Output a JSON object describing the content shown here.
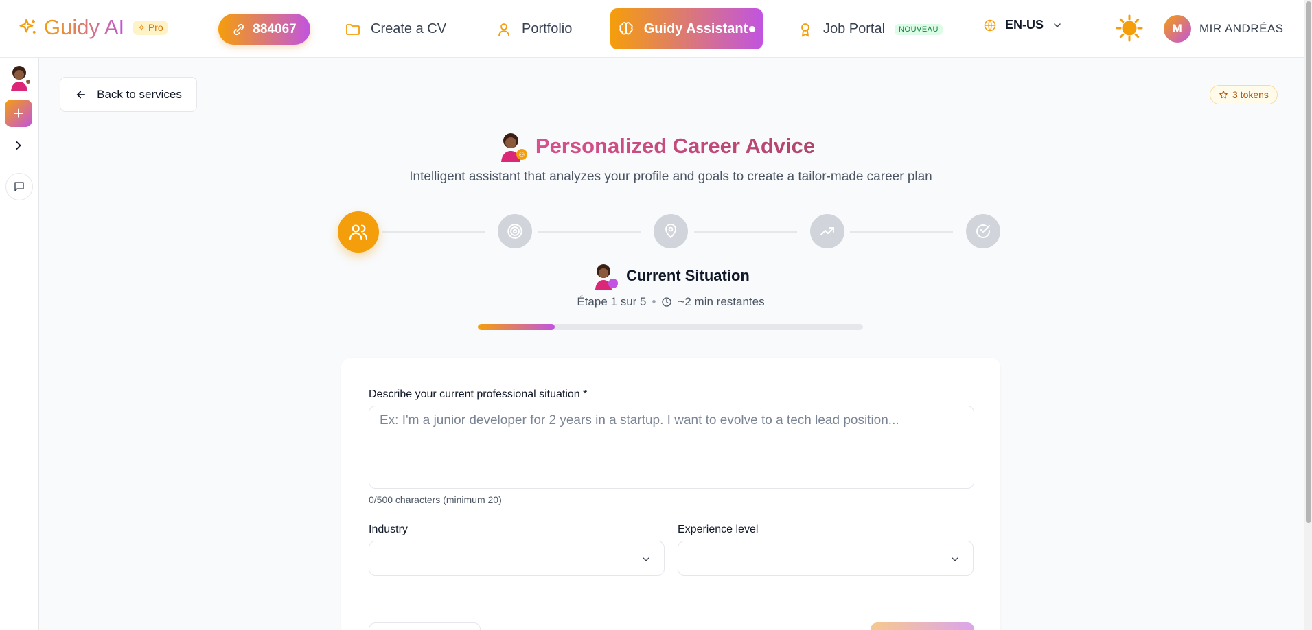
{
  "header": {
    "brand": "Guidy AI",
    "pro_badge": "Pro",
    "points": "884067",
    "nav": [
      {
        "label": "Create a CV",
        "icon": "folder-icon"
      },
      {
        "label": "Portfolio",
        "icon": "user-icon"
      },
      {
        "label": "Guidy Assistant",
        "icon": "brain-icon"
      },
      {
        "label": "Job Portal",
        "icon": "award-icon",
        "badge": "NOUVEAU"
      }
    ],
    "language": "EN-US",
    "user_initial": "M",
    "user_name": "MIR ANDRÉAS"
  },
  "back_label": "Back to services",
  "tokens": "3 tokens",
  "page": {
    "title": "Personalized Career Advice",
    "subtitle": "Intelligent assistant that analyzes your profile and goals to create a tailor-made career plan"
  },
  "stepper": {
    "steps": [
      {
        "icon": "users-icon"
      },
      {
        "icon": "target-icon"
      },
      {
        "icon": "map-pin-icon"
      },
      {
        "icon": "trending-up-icon"
      },
      {
        "icon": "check-circle-icon"
      }
    ],
    "active_index": 0,
    "current_title": "Current Situation",
    "step_label": "Étape 1 sur 5",
    "time_label": "~2 min restantes",
    "progress": 0.2
  },
  "form": {
    "situation_label": "Describe your current professional situation *",
    "situation_placeholder": "Ex: I'm a junior developer for 2 years in a startup. I want to evolve to a tech lead position...",
    "situation_value": "",
    "counter": "0/500 characters (minimum 20)",
    "industry_label": "Industry",
    "industry_value": "",
    "experience_label": "Experience level",
    "experience_value": ""
  },
  "colors": {
    "accent_orange": "#f59e0b",
    "accent_purple": "#c154e0",
    "title_pink": "#c0507e"
  }
}
